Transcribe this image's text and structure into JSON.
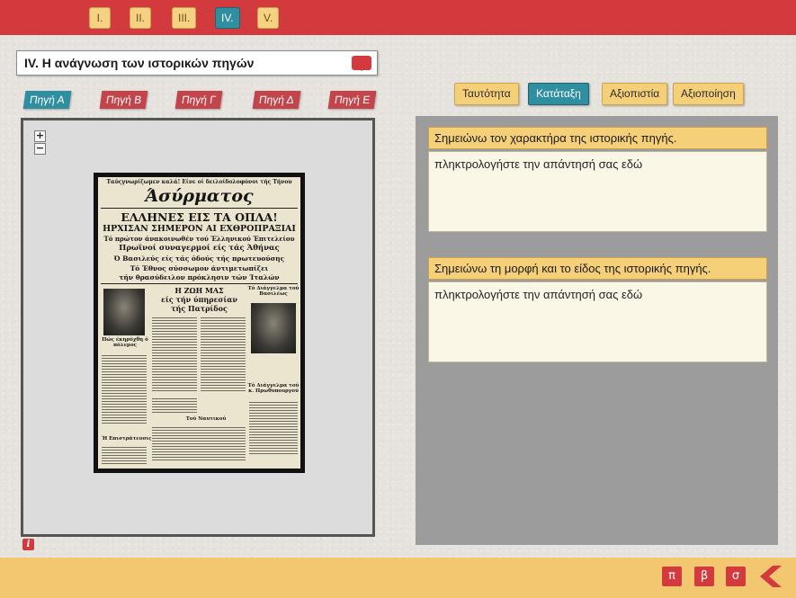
{
  "chapters": [
    "I.",
    "II.",
    "III.",
    "IV.",
    "V."
  ],
  "active_chapter_index": 3,
  "title": "IV. Η ανάγνωση των ιστορικών πηγών",
  "sources": [
    "Πηγή Α",
    "Πηγή Β",
    "Πηγή Γ",
    "Πηγή Δ",
    "Πηγή Ε"
  ],
  "active_source_index": 0,
  "zoom": {
    "in": "+",
    "out": "−"
  },
  "newspaper": {
    "top_line": "Ταύςγνωρίζωμεν καλά! Είνε οί δειλοίδολοφόνοι τής Τήνου",
    "masthead": "Άσύρματος",
    "h1": "ΕΛΛΗΝΕΣ ΕΙΣ ΤΑ ΟΠΛΑ!",
    "h2": "ΗΡΧΙΣΑΝ ΣΗΜΕΡΟΝ ΑΙ ΕΧΘΡΟΠΡΑΞΙΑΙ",
    "l1": "Τό πρώτον άνακοινωθέν τού Έλληνικού Έπιτελείου",
    "l2": "Πρωϊνοί συναγερμοί είς τάς Άθήνας",
    "l3": "Ό Βασιλεύς είς τάς όδούς τής πρωτευούσης",
    "l4": "Τό Έθνος σύσσωμον άντιμετωπίζει",
    "l5": "τήν θρασύδειλον πρόκλησιν τών Ίταλών",
    "sub1": "Η ΖΩΗ ΜΑΣ",
    "sub2": "είς τήν ύπηρεσίαν",
    "sub3": "τής Πατρίδος",
    "caption1": "Τό Διάγγελμα τού Βασιλέως",
    "caption2": "Τό Διάγγελμα τού κ. Πρωθυπουργού",
    "caption3": "Πώς έκηρύχθη ό πόλεμος",
    "caption4": "Τού Ναυτικού",
    "caption5": "Ή Επιστράτευσις"
  },
  "info_icon": "i",
  "category_tabs": [
    "Ταυτότητα",
    "Κατάταξη",
    "Αξιοπιστία",
    "Αξιοποίηση"
  ],
  "active_category_index": 1,
  "questions": [
    {
      "label": "Σημειώνω τον χαρακτήρα της ιστορικής πηγής.",
      "placeholder": "πληκτρολογήστε την απάντησή σας εδώ"
    },
    {
      "label": "Σημειώνω  τη μορφή και το είδος της ιστορικής πηγής.",
      "placeholder": "πληκτρολογήστε την απάντησή σας εδώ"
    }
  ],
  "bottom_nav": [
    "π",
    "β",
    "σ"
  ],
  "colors": {
    "accent_red": "#d33a3e",
    "accent_teal": "#2f8fa0",
    "accent_yellow": "#f6cf79"
  }
}
